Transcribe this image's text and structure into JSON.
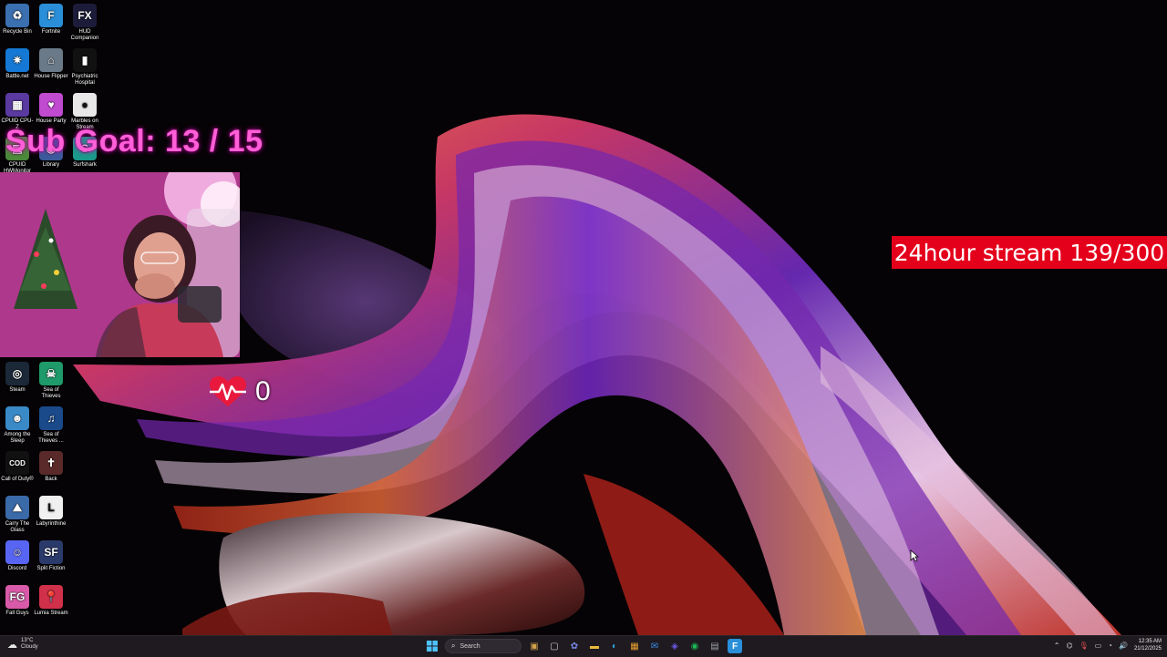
{
  "desktop": {
    "icons": [
      {
        "label": "Recycle Bin",
        "icon": "recycle-bin-icon",
        "color": "#3a6fb0",
        "glyph": "♻"
      },
      {
        "label": "Fortnite",
        "icon": "fortnite-icon",
        "color": "#2a8fd8",
        "glyph": "F"
      },
      {
        "label": "HUD Companion",
        "icon": "hud-fx-icon",
        "color": "#1c1c3a",
        "glyph": "FX"
      },
      {
        "label": "Battle.net",
        "icon": "battlenet-icon",
        "color": "#1478d4",
        "glyph": "✷"
      },
      {
        "label": "House Flipper",
        "icon": "house-flipper-icon",
        "color": "#6b7a88",
        "glyph": "⌂"
      },
      {
        "label": "Psychiatric Hospital",
        "icon": "psychiatric-hospital-icon",
        "color": "#111111",
        "glyph": "▮"
      },
      {
        "label": "CPUID CPU-Z",
        "icon": "cpu-z-icon",
        "color": "#5a3aa0",
        "glyph": "▦"
      },
      {
        "label": "House Party",
        "icon": "house-party-icon",
        "color": "#c04ad0",
        "glyph": "♥"
      },
      {
        "label": "Marbles on Stream",
        "icon": "marbles-icon",
        "color": "#e8e8e8",
        "glyph": "●"
      },
      {
        "label": "CPUID HWMonitor",
        "icon": "hwmonitor-icon",
        "color": "#4a8a3a",
        "glyph": "▤"
      },
      {
        "label": "Library",
        "icon": "library-icon",
        "color": "#3a5a9a",
        "glyph": "◉"
      },
      {
        "label": "Surfshark",
        "icon": "surfshark-icon",
        "color": "#1a9a8a",
        "glyph": "S"
      },
      {
        "label": "Steam",
        "icon": "steam-icon",
        "color": "#1b2838",
        "glyph": "◎"
      },
      {
        "label": "Sea of Thieves",
        "icon": "sea-of-thieves-icon",
        "color": "#1f9a6a",
        "glyph": "☠"
      },
      {
        "label": "Among the Sleep",
        "icon": "among-the-sleep-icon",
        "color": "#3a8ac8",
        "glyph": "☻"
      },
      {
        "label": "Sea of Thieves ...",
        "icon": "music-note-icon",
        "color": "#1a4a8a",
        "glyph": "♫"
      },
      {
        "label": "Call of Duty®",
        "icon": "call-of-duty-icon",
        "color": "#111111",
        "glyph": "COD"
      },
      {
        "label": "Back",
        "icon": "back-game-icon",
        "color": "#5a2a2a",
        "glyph": "✝"
      },
      {
        "label": "Carry The Glass",
        "icon": "carry-the-glass-icon",
        "color": "#3a6aa8",
        "glyph": "⛰"
      },
      {
        "label": "Labyrinthine",
        "icon": "labyrinthine-icon",
        "color": "#f0f0f0",
        "glyph": "L"
      },
      {
        "label": "Discord",
        "icon": "discord-icon",
        "color": "#5865f2",
        "glyph": "☺"
      },
      {
        "label": "Split Fiction",
        "icon": "split-fiction-icon",
        "color": "#2a3a6a",
        "glyph": "SF"
      },
      {
        "label": "Fall Guys",
        "icon": "fall-guys-icon",
        "color": "#d85aa8",
        "glyph": "FG"
      },
      {
        "label": "Lumia Stream",
        "icon": "lumia-stream-icon",
        "color": "#d0304a",
        "glyph": "📍"
      }
    ]
  },
  "overlays": {
    "sub_goal": "Sub Goal:  13 / 15",
    "heart_count": "0",
    "stream_banner": "24hour stream 139/300"
  },
  "taskbar": {
    "weather_temp": "13°C",
    "weather_desc": "Cloudy",
    "search_placeholder": "Search",
    "time": "12:35 AM",
    "date": "21/12/2025",
    "pinned": [
      {
        "name": "widgets-icon",
        "glyph": "▣",
        "color": "#d4a24a"
      },
      {
        "name": "task-view-icon",
        "glyph": "▢",
        "color": "#cfcfcf"
      },
      {
        "name": "copilot-icon",
        "glyph": "✿",
        "color": "#7a8af0"
      },
      {
        "name": "file-explorer-icon",
        "glyph": "▬",
        "color": "#e8b93a"
      },
      {
        "name": "edge-icon",
        "glyph": "◐",
        "color": "#2ea6d8"
      },
      {
        "name": "store-icon",
        "glyph": "▦",
        "color": "#e8a030"
      },
      {
        "name": "mail-icon",
        "glyph": "✉",
        "color": "#3a8ae8"
      },
      {
        "name": "streamer-bot-icon",
        "glyph": "◈",
        "color": "#6a5ae8"
      },
      {
        "name": "spotify-icon",
        "glyph": "◉",
        "color": "#1db954"
      },
      {
        "name": "xbox-icon",
        "glyph": "▤",
        "color": "#9aa0a8"
      },
      {
        "name": "fortnite-taskbar-icon",
        "glyph": "F",
        "color": "#2a8fd8"
      }
    ]
  },
  "colors": {
    "sub_goal": "#ff5fd7",
    "banner_bg": "#e4001b",
    "taskbar_bg": "#1e1a1f",
    "heart": "#e8193c"
  }
}
